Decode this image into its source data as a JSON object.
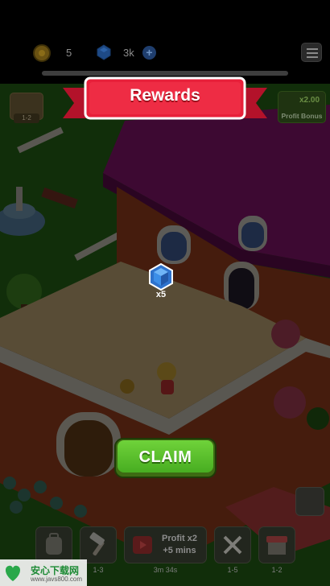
{
  "hud": {
    "coins": "5",
    "gems": "3k",
    "plus": "+",
    "progress_fraction": 0.0
  },
  "dialog": {
    "title": "Rewards",
    "reward": {
      "icon": "blue-gem-icon",
      "quantity": "x5"
    },
    "claim_label": "CLAIM"
  },
  "side": {
    "map_level": "1-2",
    "profit_multiplier": "x2.00",
    "profit_label": "Profit Bonus"
  },
  "toolbar": {
    "items": [
      {
        "icon": "backpack-icon",
        "sub": ""
      },
      {
        "icon": "hammer-icon",
        "sub": "1-3"
      },
      {
        "icon": "tv-ad-icon",
        "line1": "Profit x2",
        "line2": "+5 mins",
        "sub": "3m 34s"
      },
      {
        "icon": "crossed-swords-icon",
        "sub": "1-5"
      },
      {
        "icon": "shop-icon",
        "sub": "1-2"
      }
    ]
  },
  "watermark": {
    "title": "安心下载网",
    "url": "www.javs800.com"
  },
  "colors": {
    "banner_red": "#e8203a",
    "claim_green": "#56bd2a",
    "gem_blue": "#3c8ee8"
  }
}
